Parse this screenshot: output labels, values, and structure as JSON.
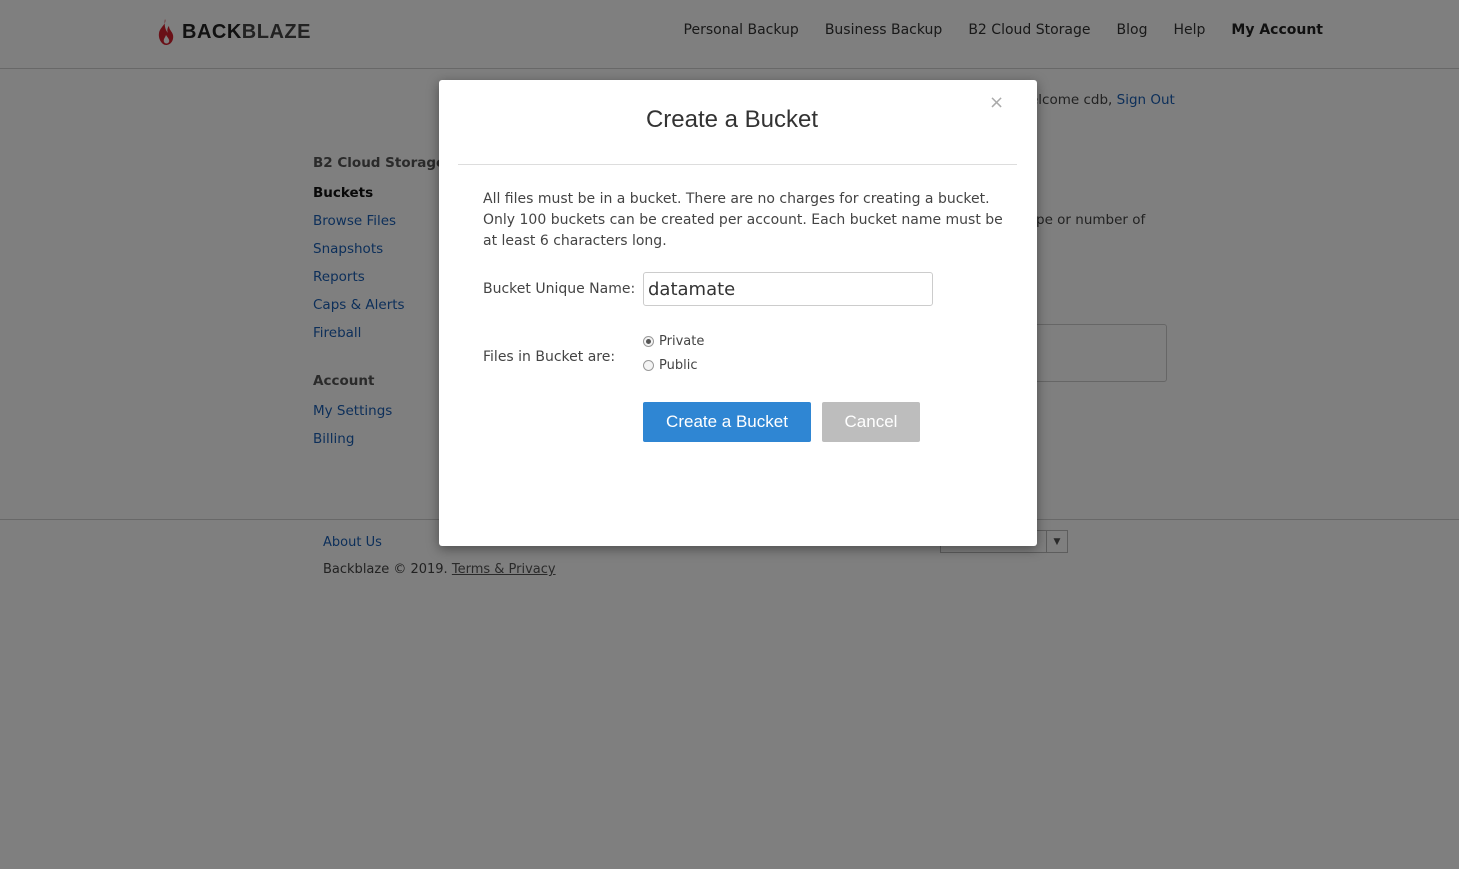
{
  "brand": {
    "logo_back": "BACK",
    "logo_blaze": "BLAZE",
    "flame_color": "#d4212f"
  },
  "nav": {
    "items": [
      {
        "label": "Personal Backup"
      },
      {
        "label": "Business Backup"
      },
      {
        "label": "B2 Cloud Storage"
      },
      {
        "label": "Blog"
      },
      {
        "label": "Help"
      },
      {
        "label": "My Account"
      }
    ]
  },
  "welcome": {
    "text": "elcome cdb,",
    "signout": "Sign Out"
  },
  "sidebar": {
    "section1_heading": "B2 Cloud Storage",
    "items": [
      {
        "label": "Buckets"
      },
      {
        "label": "Browse Files"
      },
      {
        "label": "Snapshots"
      },
      {
        "label": "Reports"
      },
      {
        "label": "Caps & Alerts"
      },
      {
        "label": "Fireball"
      }
    ],
    "section2_heading": "Account",
    "account_items": [
      {
        "label": "My Settings"
      },
      {
        "label": "Billing"
      }
    ]
  },
  "background": {
    "fragment_text": "pe or number of"
  },
  "footer": {
    "about": "About Us",
    "copyright": "Backblaze © 2019.",
    "terms": "Terms & Privacy"
  },
  "modal": {
    "title": "Create a Bucket",
    "close": "×",
    "description": "All files must be in a bucket. There are no charges for creating a bucket. Only 100 buckets can be created per account. Each bucket name must be at least 6 characters long.",
    "name_label": "Bucket Unique Name:",
    "name_value": "datamate",
    "files_label": "Files in Bucket are:",
    "option_private": "Private",
    "option_public": "Public",
    "selected_option": "Private",
    "create_button": "Create a Bucket",
    "cancel_button": "Cancel"
  },
  "colors": {
    "primary_button": "#2f86d3",
    "cancel_button": "#bdbdbd",
    "link": "#1a5fb4"
  }
}
